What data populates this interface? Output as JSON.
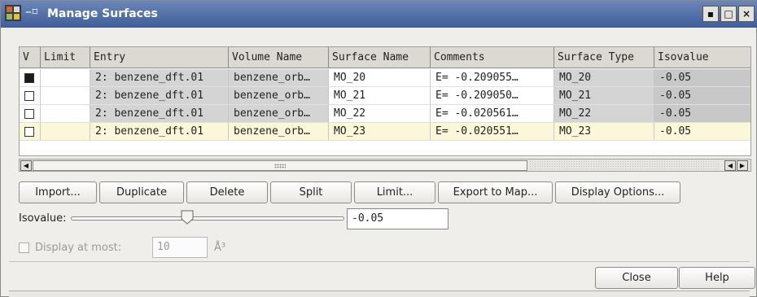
{
  "window": {
    "title": "Manage Surfaces",
    "pin_glyph": "−⌑",
    "controls": {
      "minimize": "▪",
      "maximize": "□",
      "close": "×"
    }
  },
  "table": {
    "columns": [
      "V",
      "Limit",
      "Entry",
      "Volume Name",
      "Surface Name",
      "Comments",
      "Surface Type",
      "Isovalue"
    ],
    "rows": [
      {
        "visible": true,
        "limit": "",
        "entry": "2: benzene_dft.01",
        "volume_name": "benzene_orb…",
        "surface_name": "MO_20",
        "comments": "E=    -0.209055…",
        "surface_type": "MO_20",
        "isovalue": "-0.05"
      },
      {
        "visible": false,
        "limit": "",
        "entry": "2: benzene_dft.01",
        "volume_name": "benzene_orb…",
        "surface_name": "MO_21",
        "comments": "E=    -0.209050…",
        "surface_type": "MO_21",
        "isovalue": "-0.05"
      },
      {
        "visible": false,
        "limit": "",
        "entry": "2: benzene_dft.01",
        "volume_name": "benzene_orb…",
        "surface_name": "MO_22",
        "comments": "E=    -0.020561…",
        "surface_type": "MO_22",
        "isovalue": "-0.05"
      },
      {
        "visible": false,
        "limit": "",
        "entry": "2: benzene_dft.01",
        "volume_name": "benzene_orb…",
        "surface_name": "MO_23",
        "comments": "E=    -0.020551…",
        "surface_type": "MO_23",
        "isovalue": "-0.05"
      }
    ]
  },
  "buttons": {
    "import": "Import...",
    "duplicate": "Duplicate",
    "delete": "Delete",
    "split": "Split",
    "limit": "Limit...",
    "export_to_map": "Export to Map...",
    "display_options": "Display Options...",
    "close": "Close",
    "help": "Help"
  },
  "isovalue": {
    "label": "Isovalue:",
    "value": "-0.05"
  },
  "display_at_most": {
    "label": "Display at most:",
    "value": "10",
    "unit": "Å³",
    "enabled": false
  },
  "colors": {
    "titlebar": "#4a6aa5",
    "row_gray": "#d4d4d4",
    "row_gray_alt": "#c8c8c8",
    "row_highlight": "#fbf7d9",
    "header": "#dcd9d3"
  }
}
